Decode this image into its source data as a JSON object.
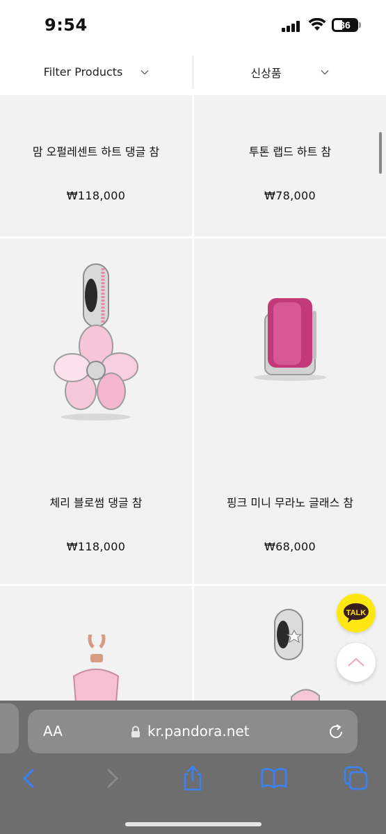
{
  "status": {
    "time": "9:54",
    "battery": "36"
  },
  "filter_bar": {
    "filter_label": "Filter Products",
    "sort_label": "신상품"
  },
  "products": [
    {
      "name": "맘 오펄레센트 하트 댕글 참",
      "price": "₩118,000"
    },
    {
      "name": "투톤 랩드 하트 참",
      "price": "₩78,000"
    },
    {
      "name": "체리 블로썸 댕글 참",
      "price": "₩118,000"
    },
    {
      "name": "핑크 미니 무라노 글래스 참",
      "price": "₩68,000"
    }
  ],
  "floating": {
    "talk_label": "TALK"
  },
  "safari": {
    "aa_label": "AA",
    "url": "kr.pandora.net"
  },
  "colors": {
    "kakao": "#ffe812",
    "safari_accent": "#3b82f6",
    "card_bg": "#f2f2f2"
  }
}
